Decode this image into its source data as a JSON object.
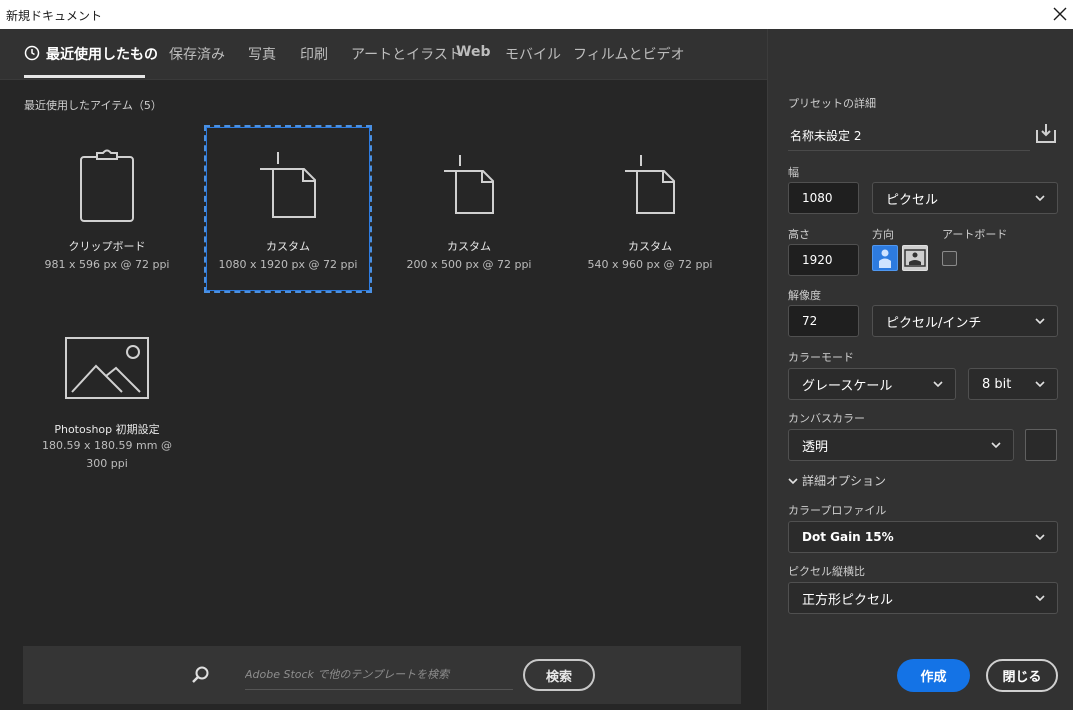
{
  "window": {
    "title": "新規ドキュメント"
  },
  "tabs": [
    {
      "label": "最近使用したもの"
    },
    {
      "label": "保存済み"
    },
    {
      "label": "写真"
    },
    {
      "label": "印刷"
    },
    {
      "label": "アートとイラスト"
    },
    {
      "label": "Web"
    },
    {
      "label": "モバイル"
    },
    {
      "label": "フィルムとビデオ"
    }
  ],
  "recent": {
    "title": "最近使用したアイテム（5）",
    "items": [
      {
        "name": "クリップボード",
        "spec": "981 x 596 px @ 72 ppi"
      },
      {
        "name": "カスタム",
        "spec": "1080 x 1920 px @ 72 ppi"
      },
      {
        "name": "カスタム",
        "spec": "200 x 500 px @ 72 ppi"
      },
      {
        "name": "カスタム",
        "spec": "540 x 960 px @ 72 ppi"
      },
      {
        "name": "Photoshop 初期設定",
        "spec": "180.59 x 180.59 mm @ 300 ppi"
      }
    ]
  },
  "search": {
    "placeholder": "Adobe Stock で他のテンプレートを検索",
    "button": "検索"
  },
  "panel": {
    "header": "プリセットの詳細",
    "preset_name": "名称未設定 2",
    "width_label": "幅",
    "width_value": "1080",
    "width_unit": "ピクセル",
    "height_label": "高さ",
    "height_value": "1920",
    "orientation_label": "方向",
    "artboard_label": "アートボード",
    "resolution_label": "解像度",
    "resolution_value": "72",
    "resolution_unit": "ピクセル/インチ",
    "color_mode_label": "カラーモード",
    "color_mode_value": "グレースケール",
    "bit_depth": "8 bit",
    "canvas_color_label": "カンバスカラー",
    "canvas_color_value": "透明",
    "advanced_label": "詳細オプション",
    "color_profile_label": "カラープロファイル",
    "color_profile_value": "Dot Gain 15%",
    "pixel_aspect_label": "ピクセル縦横比",
    "pixel_aspect_value": "正方形ピクセル",
    "create_button": "作成",
    "close_button": "閉じる"
  }
}
